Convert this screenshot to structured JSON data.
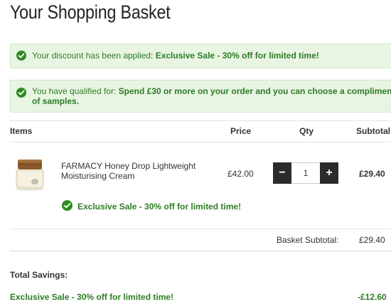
{
  "page": {
    "title": "Your Shopping Basket"
  },
  "notices": {
    "discount": {
      "prefix": "Your discount has been applied:",
      "highlight": "Exclusive Sale - 30% off for limited time!"
    },
    "qualified": {
      "prefix": "You have qualified for:",
      "highlight_line1": "Spend £30 or more on your order and you can choose a complimen",
      "highlight_line2": "of samples."
    }
  },
  "table": {
    "headers": {
      "items": "Items",
      "price": "Price",
      "qty": "Qty",
      "subtotal": "Subtotal"
    }
  },
  "item": {
    "name": "FARMACY Honey Drop Lightweight Moisturising Cream",
    "price": "£42.00",
    "quantity": "1",
    "subtotal": "£29.40",
    "promotion": "Exclusive Sale - 30% off for limited time!"
  },
  "stepper": {
    "minus": "−",
    "plus": "+"
  },
  "summary": {
    "basket_subtotal_label": "Basket Subtotal:",
    "basket_subtotal_value": "£29.40"
  },
  "savings": {
    "title": "Total Savings:",
    "label": "Exclusive Sale - 30% off for limited time!",
    "value": "-£12.60"
  },
  "colors": {
    "notice_bg": "#e8f5e2",
    "notice_text": "#2f7a28",
    "success_green": "#2e8b22",
    "stepper_dark": "#2b2b2b"
  }
}
